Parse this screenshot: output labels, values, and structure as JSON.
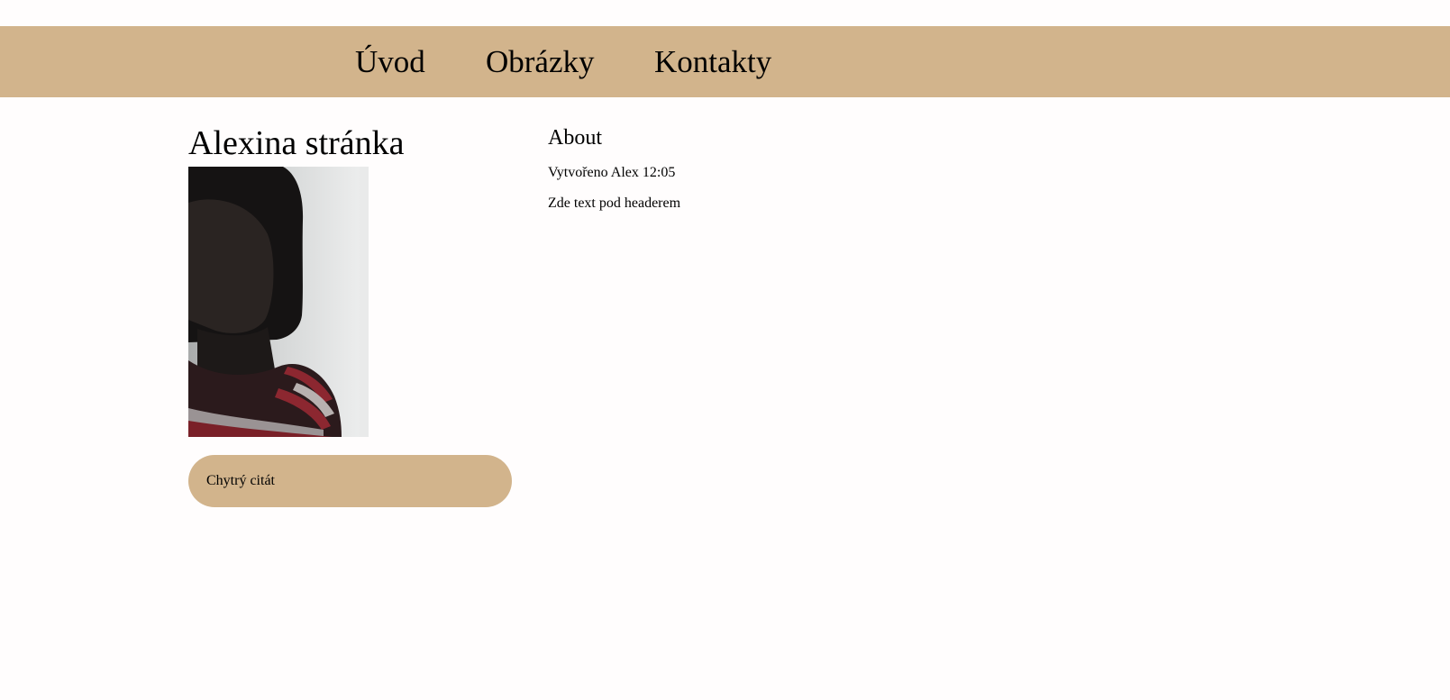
{
  "nav": {
    "items": [
      {
        "label": "Úvod"
      },
      {
        "label": "Obrázky"
      },
      {
        "label": "Kontakty"
      }
    ]
  },
  "sidebar": {
    "title": "Alexina stránka",
    "quote": "Chytrý citát"
  },
  "main": {
    "heading": "About",
    "meta": "Vytvořeno Alex 12:05",
    "text": "Zde text pod headerem"
  },
  "colors": {
    "accent": "#d2b48c",
    "background": "#fffdfd",
    "text": "#000000"
  }
}
